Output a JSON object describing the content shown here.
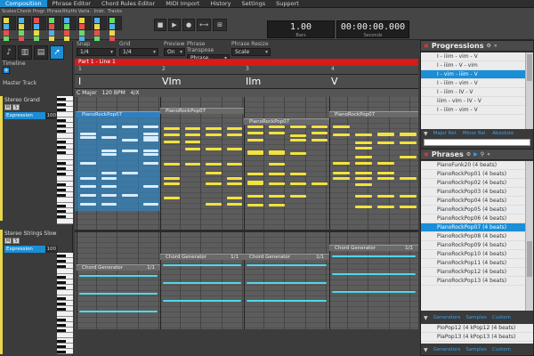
{
  "menu": [
    {
      "label": "Composition",
      "active": true
    },
    {
      "label": "Phrase Editor",
      "active": false
    },
    {
      "label": "Chord Rules Editor",
      "active": false
    },
    {
      "label": "MIDI Import",
      "active": false
    },
    {
      "label": "History",
      "active": false
    },
    {
      "label": "Settings",
      "active": false
    },
    {
      "label": "Support",
      "active": false
    }
  ],
  "toolbar": {
    "tools": [
      "Scales",
      "Chords",
      "Progr.",
      "Phrases",
      "Rhythm",
      "Varia.",
      "Instr.",
      "Tracks"
    ],
    "tool_icons": [
      "scales-icon",
      "chords-icon",
      "progressions-icon",
      "phrases-icon",
      "rhythm-icon",
      "variations-icon",
      "instruments-icon",
      "tracks-icon"
    ],
    "transport": [
      {
        "name": "stop-icon",
        "glyph": "■"
      },
      {
        "name": "play-icon",
        "glyph": "▶"
      },
      {
        "name": "record-icon",
        "glyph": "●"
      },
      {
        "name": "loop-icon",
        "glyph": "⟷"
      },
      {
        "name": "metronome-icon",
        "glyph": "⊞"
      }
    ],
    "bars_value": "1.00",
    "bars_label": "Bars",
    "seconds_value": "00:00:00.000",
    "seconds_label": "Seconds"
  },
  "options": {
    "snap_label": "Snap",
    "snap_value": "1/4",
    "grid_label": "Grid",
    "grid_value": "1/4",
    "preview_label": "Preview",
    "preview_value": "On",
    "transpose_label": "Phrase Transpose",
    "transpose_value": "Phrase",
    "resize_label": "Phrase Resize",
    "resize_value": "Scale"
  },
  "left": {
    "timeline_label": "Timeline",
    "master_label": "Master Track",
    "track1_name": "Stereo Grand",
    "track2_name": "Stereo Strings Slow",
    "mute": "M",
    "solo": "S",
    "expression_label": "Expression",
    "expression_value": "100"
  },
  "timeline": {
    "part_label": "Part 1 - Line 1",
    "bars": [
      "1",
      "2",
      "3",
      "4"
    ],
    "chords": [
      "I",
      "VIm",
      "IIm",
      "V"
    ],
    "key": "C Major",
    "tempo": "120 BPM",
    "meter": "4/X"
  },
  "roll": {
    "phrase_blocks": [
      {
        "label": "PianoRockPop07",
        "selected": true
      },
      {
        "label": "PianoRockPop07",
        "selected": false
      },
      {
        "label": "PianoRockPop07",
        "selected": false
      },
      {
        "label": "PianoRockPop07",
        "selected": false
      }
    ],
    "generator_blocks": [
      "Chord Generator",
      "Chord Generator",
      "Chord Generator",
      "Chord Generator"
    ],
    "generator_counter": "1/1"
  },
  "progressions": {
    "title": "Progressions",
    "items": [
      {
        "label": "I - iiim - vim - V",
        "selected": false
      },
      {
        "label": "I - iiim - V - vim",
        "selected": false
      },
      {
        "label": "I - vim - iiim - V",
        "selected": true
      },
      {
        "label": "I - iiim - vim - V",
        "selected": false
      },
      {
        "label": "I - iiim - IV - V",
        "selected": false
      },
      {
        "label": "iiim - vim - IV - V",
        "selected": false
      },
      {
        "label": "I - iiim - vim - V",
        "selected": false
      }
    ],
    "tabs": [
      "Major Rel.",
      "Minor Rel.",
      "Absolute"
    ]
  },
  "phrases": {
    "title": "Phrases",
    "items": [
      {
        "label": "PianoFunk20 (4 beats)",
        "selected": false
      },
      {
        "label": "PianoRockPop01 (4 beats)",
        "selected": false
      },
      {
        "label": "PianoRockPop02 (4 beats)",
        "selected": false
      },
      {
        "label": "PianoRockPop03 (4 beats)",
        "selected": false
      },
      {
        "label": "PianoRockPop04 (4 beats)",
        "selected": false
      },
      {
        "label": "PianoRockPop05 (4 beats)",
        "selected": false
      },
      {
        "label": "PianoRockPop06 (4 beats)",
        "selected": false
      },
      {
        "label": "PianoRockPop07 (4 beats)",
        "selected": true
      },
      {
        "label": "PianoRockPop08 (4 beats)",
        "selected": false
      },
      {
        "label": "PianoRockPop09 (4 beats)",
        "selected": false
      },
      {
        "label": "PianoRockPop10 (4 beats)",
        "selected": false
      },
      {
        "label": "PianoRockPop11 (4 beats)",
        "selected": false
      },
      {
        "label": "PianoRockPop12 (4 beats)",
        "selected": false
      },
      {
        "label": "PianoRockPop13 (4 beats)",
        "selected": false
      }
    ],
    "tabs": [
      "Generators",
      "Samples",
      "Custom"
    ],
    "bottom_items": [
      "PioPop12 (4 kPop12 (4 beats)",
      "PiaPop13 (4 kPop13 (4 beats)"
    ],
    "bottom_tabs": [
      "Generators",
      "Samples",
      "Custom"
    ]
  },
  "colors": {
    "accent": "#1a8ed6",
    "note_yellow": "#f2e23e",
    "note_cyan": "#4fd8e8",
    "part_red": "#d81a1a"
  }
}
